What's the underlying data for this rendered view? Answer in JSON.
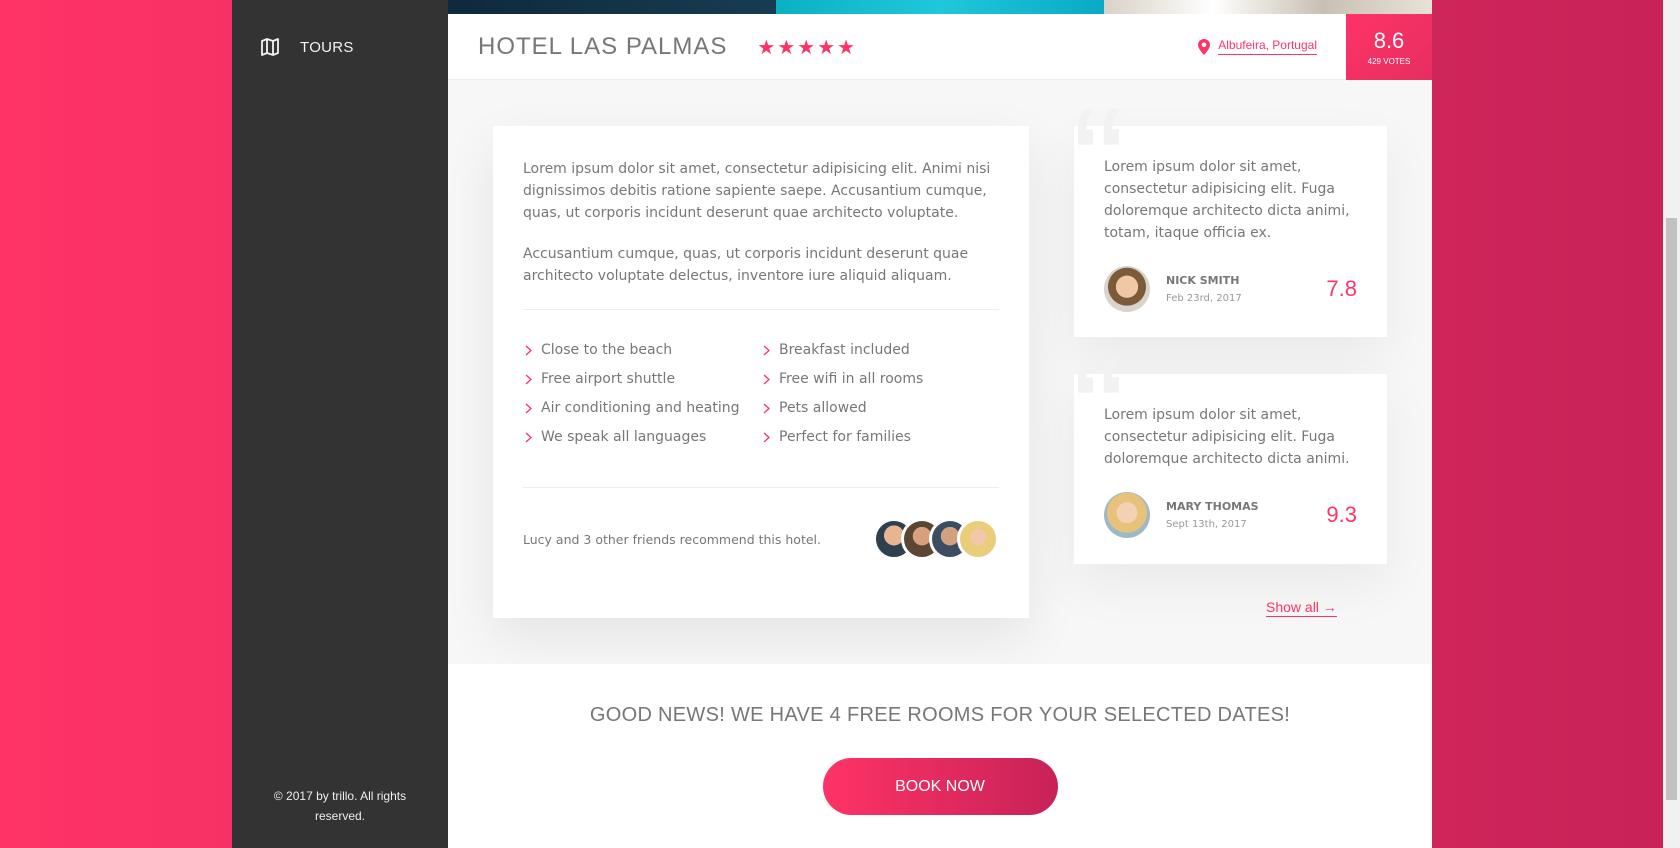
{
  "sidebar": {
    "nav_items": [
      {
        "label": "TOURS",
        "icon": "map-icon"
      }
    ],
    "copyright": "© 2017 by trillo. All rights reserved."
  },
  "hotel": {
    "name": "HOTEL LAS PALMAS",
    "stars": "★★★★★",
    "location": "Albufeira, Portugal",
    "rating_average": "8.6",
    "rating_count": "429 VOTES"
  },
  "description": {
    "paragraphs": [
      "Lorem ipsum dolor sit amet, consectetur adipisicing elit. Animi nisi dignissimos debitis ratione sapiente saepe. Accusantium cumque, quas, ut corporis incidunt deserunt quae architecto voluptate.",
      "Accusantium cumque, quas, ut corporis incidunt deserunt quae architecto voluptate delectus, inventore iure aliquid aliquam."
    ],
    "features": [
      "Close to the beach",
      "Breakfast included",
      "Free airport shuttle",
      "Free wifi in all rooms",
      "Air conditioning and heating",
      "Pets allowed",
      "We speak all languages",
      "Perfect for families"
    ],
    "recommend_text": "Lucy and 3 other friends recommend this hotel."
  },
  "reviews": [
    {
      "text": "Lorem ipsum dolor sit amet, consectetur adipisicing elit. Fuga doloremque architecto dicta animi, totam, itaque officia ex.",
      "name": "NICK SMITH",
      "date": "Feb 23rd, 2017",
      "score": "7.8"
    },
    {
      "text": "Lorem ipsum dolor sit amet, consectetur adipisicing elit. Fuga doloremque architecto dicta animi.",
      "name": "MARY THOMAS",
      "date": "Sept 13th, 2017",
      "score": "9.3"
    }
  ],
  "show_all": "Show all →",
  "cta": {
    "title": "GOOD NEWS! WE HAVE 4 FREE ROOMS FOR YOUR SELECTED DATES!",
    "button": "BOOK NOW"
  },
  "colors": {
    "primary": "#ff3366",
    "sidebar": "#333333",
    "text": "#777777"
  }
}
